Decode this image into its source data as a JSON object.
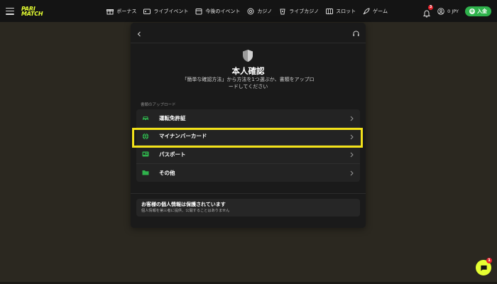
{
  "header": {
    "logo_line1": "PARI",
    "logo_line2": "MATCH",
    "nav": [
      {
        "label": "ボーナス",
        "icon": "gift-icon"
      },
      {
        "label": "ライブイベント",
        "icon": "live-tv-icon"
      },
      {
        "label": "今後のイベント",
        "icon": "calendar-icon"
      },
      {
        "label": "カジノ",
        "icon": "casino-chip-icon"
      },
      {
        "label": "ライブカジノ",
        "icon": "live-casino-icon"
      },
      {
        "label": "スロット",
        "icon": "slot-icon"
      },
      {
        "label": "ゲーム",
        "icon": "rocket-icon"
      }
    ],
    "notification_count": "3",
    "balance": "0 JPY",
    "deposit_label": "入金"
  },
  "modal": {
    "title": "本人確認",
    "subtitle": "「簡単な確認方法」から方法を1つ選ぶか、書類をアップロードしてください",
    "section_label": "書類のアップロード",
    "documents": [
      {
        "label": "運転免許証",
        "icon": "car-icon"
      },
      {
        "label": "マイナンバーカード",
        "icon": "globe-icon"
      },
      {
        "label": "パスポート",
        "icon": "passport-icon"
      },
      {
        "label": "その他",
        "icon": "folder-icon"
      }
    ],
    "privacy_title": "お客様の個人情報は保護されています",
    "privacy_desc": "個人情報を第三者に提供、公開することはありません"
  },
  "chat": {
    "badge_count": "1"
  },
  "colors": {
    "accent": "#e6ff32",
    "icon_green": "#2fb24c",
    "highlight": "#f3e21a",
    "badge_red": "#e5222b",
    "background": "#2b2820"
  }
}
